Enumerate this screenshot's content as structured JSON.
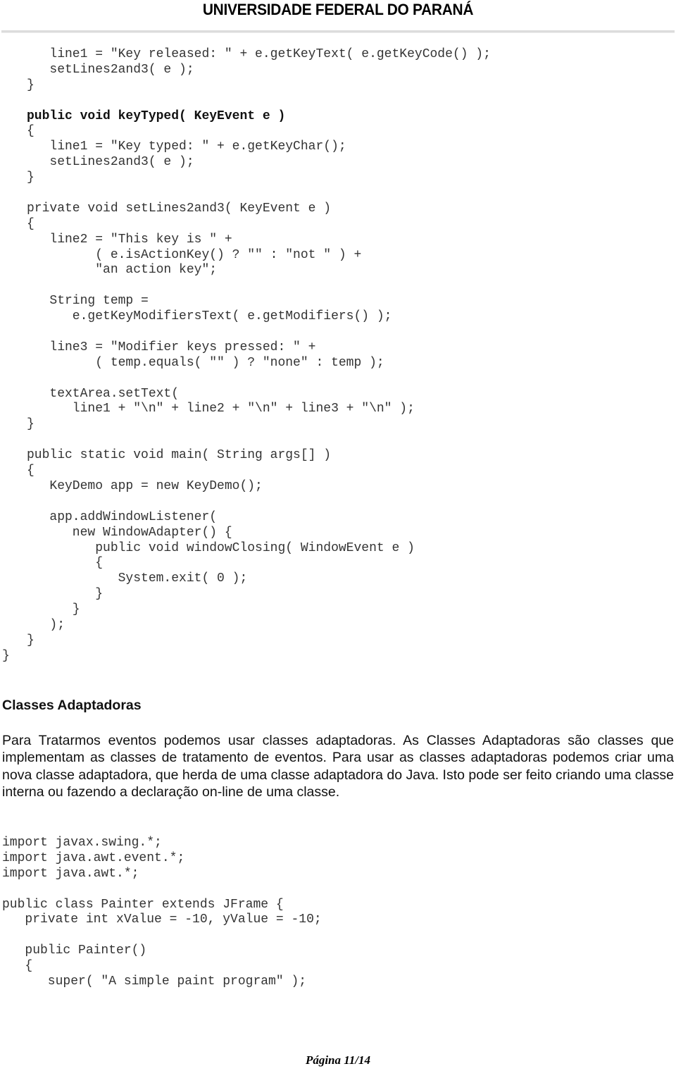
{
  "header": {
    "title": "UNIVERSIDADE FEDERAL DO PARANÁ"
  },
  "code_block_1": {
    "lines": [
      {
        "text": "   line1 = \"Key released: \" + e.getKeyText( e.getKeyCode() );",
        "bold": false
      },
      {
        "text": "   setLines2and3( e );",
        "bold": false
      },
      {
        "text": "}",
        "bold": false
      },
      {
        "text": "",
        "bold": false
      },
      {
        "text": "public void keyTyped( KeyEvent e )",
        "bold": true
      },
      {
        "text": "{",
        "bold": false
      },
      {
        "text": "   line1 = \"Key typed: \" + e.getKeyChar();",
        "bold": false
      },
      {
        "text": "   setLines2and3( e );",
        "bold": false
      },
      {
        "text": "}",
        "bold": false
      },
      {
        "text": "",
        "bold": false
      },
      {
        "text": "private void setLines2and3( KeyEvent e )",
        "bold": false
      },
      {
        "text": "{",
        "bold": false
      },
      {
        "text": "   line2 = \"This key is \" +",
        "bold": false
      },
      {
        "text": "         ( e.isActionKey() ? \"\" : \"not \" ) +",
        "bold": false
      },
      {
        "text": "         \"an action key\";",
        "bold": false
      },
      {
        "text": "",
        "bold": false
      },
      {
        "text": "   String temp =",
        "bold": false
      },
      {
        "text": "      e.getKeyModifiersText( e.getModifiers() );",
        "bold": false
      },
      {
        "text": "",
        "bold": false
      },
      {
        "text": "   line3 = \"Modifier keys pressed: \" +",
        "bold": false
      },
      {
        "text": "         ( temp.equals( \"\" ) ? \"none\" : temp );",
        "bold": false
      },
      {
        "text": "",
        "bold": false
      },
      {
        "text": "   textArea.setText(",
        "bold": false
      },
      {
        "text": "      line1 + \"\\n\" + line2 + \"\\n\" + line3 + \"\\n\" );",
        "bold": false
      },
      {
        "text": "}",
        "bold": false
      },
      {
        "text": "",
        "bold": false
      },
      {
        "text": "public static void main( String args[] )",
        "bold": false
      },
      {
        "text": "{",
        "bold": false
      },
      {
        "text": "   KeyDemo app = new KeyDemo();",
        "bold": false
      },
      {
        "text": "",
        "bold": false
      },
      {
        "text": "   app.addWindowListener(",
        "bold": false
      },
      {
        "text": "      new WindowAdapter() {",
        "bold": false
      },
      {
        "text": "         public void windowClosing( WindowEvent e )",
        "bold": false
      },
      {
        "text": "         {",
        "bold": false
      },
      {
        "text": "            System.exit( 0 );",
        "bold": false
      },
      {
        "text": "         }",
        "bold": false
      },
      {
        "text": "      }",
        "bold": false
      },
      {
        "text": "   );",
        "bold": false
      },
      {
        "text": "}",
        "bold": false
      }
    ],
    "outer_lines": [
      {
        "text": "}",
        "bold": false
      }
    ]
  },
  "section": {
    "heading": "Classes Adaptadoras",
    "paragraph": "Para Tratarmos eventos podemos usar classes adaptadoras. As Classes Adaptadoras são classes que implementam as classes de tratamento de eventos. Para usar as classes adaptadoras podemos criar uma nova classe adaptadora, que herda de uma classe adaptadora do Java. Isto pode ser feito criando uma classe interna ou fazendo a declaração on-line de uma classe."
  },
  "code_block_2": {
    "lines": [
      {
        "text": "import javax.swing.*;",
        "bold": false
      },
      {
        "text": "import java.awt.event.*;",
        "bold": false
      },
      {
        "text": "import java.awt.*;",
        "bold": false
      },
      {
        "text": "",
        "bold": false
      },
      {
        "text": "public class Painter extends JFrame {",
        "bold": false
      },
      {
        "text": "   private int xValue = -10, yValue = -10;",
        "bold": false
      },
      {
        "text": "",
        "bold": false
      },
      {
        "text": "   public Painter()",
        "bold": false
      },
      {
        "text": "   {",
        "bold": false
      },
      {
        "text": "      super( \"A simple paint program\" );",
        "bold": false
      }
    ]
  },
  "footer": {
    "page_label": "Página 11/14"
  }
}
